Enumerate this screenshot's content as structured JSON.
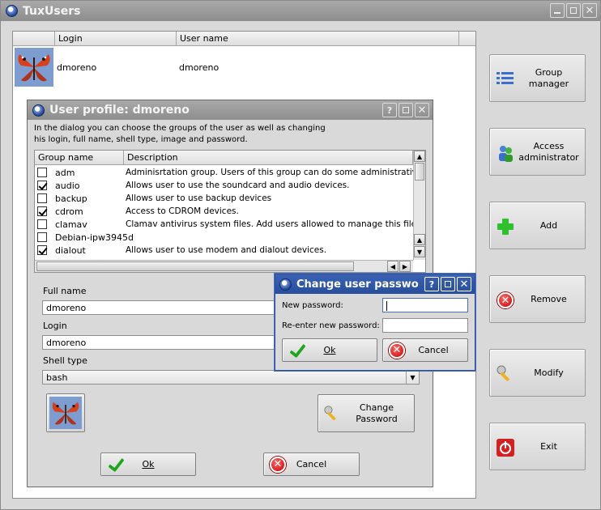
{
  "main_window": {
    "title": "TuxUsers",
    "users_table": {
      "columns": [
        "Login",
        "User name"
      ],
      "rows": [
        {
          "login": "dmoreno",
          "user_name": "dmoreno"
        }
      ]
    },
    "side_buttons": {
      "group_manager": "Group\nmanager",
      "access_administrator": "Access\nadministrator",
      "add": "Add",
      "remove": "Remove",
      "modify": "Modify",
      "exit": "Exit"
    }
  },
  "profile_dialog": {
    "title": "User profile: dmoreno",
    "description_line1": "In the dialog you can choose the groups of the user as well as changing",
    "description_line2": "his login, full name, shell type, image and password.",
    "groups_columns": [
      "Group name",
      "Description"
    ],
    "groups": [
      {
        "name": "adm",
        "checked": false,
        "description": "Adminisrtation group. Users of this group can do some administrative tas"
      },
      {
        "name": "audio",
        "checked": true,
        "description": "Allows user to use the soundcard and audio devices."
      },
      {
        "name": "backup",
        "checked": false,
        "description": "Allows user to use backup devices"
      },
      {
        "name": "cdrom",
        "checked": true,
        "description": "Access to CDROM devices."
      },
      {
        "name": "clamav",
        "checked": false,
        "description": "Clamav antivirus system files. Add users allowed to manage this files."
      },
      {
        "name": "Debian-ipw3945d",
        "checked": false,
        "description": ""
      },
      {
        "name": "dialout",
        "checked": true,
        "description": "Allows user to use modem and dialout devices."
      }
    ],
    "full_name_label": "Full name",
    "full_name_value": "dmoreno",
    "login_label": "Login",
    "login_value": "dmoreno",
    "shell_label": "Shell type",
    "shell_value": "bash",
    "change_password_button": "Change\nPassword",
    "ok_button": "Ok",
    "cancel_button": "Cancel"
  },
  "password_dialog": {
    "title": "Change user passwo",
    "new_password_label": "New password:",
    "new_password_value": "",
    "reenter_label": "Re-enter new password:",
    "reenter_value": "",
    "ok_button": "Ok",
    "cancel_button": "Cancel"
  },
  "colors": {
    "active_title": "#2f58a8",
    "inactive_title": "#9a9a9a",
    "window_bg": "#d9d9d9"
  }
}
